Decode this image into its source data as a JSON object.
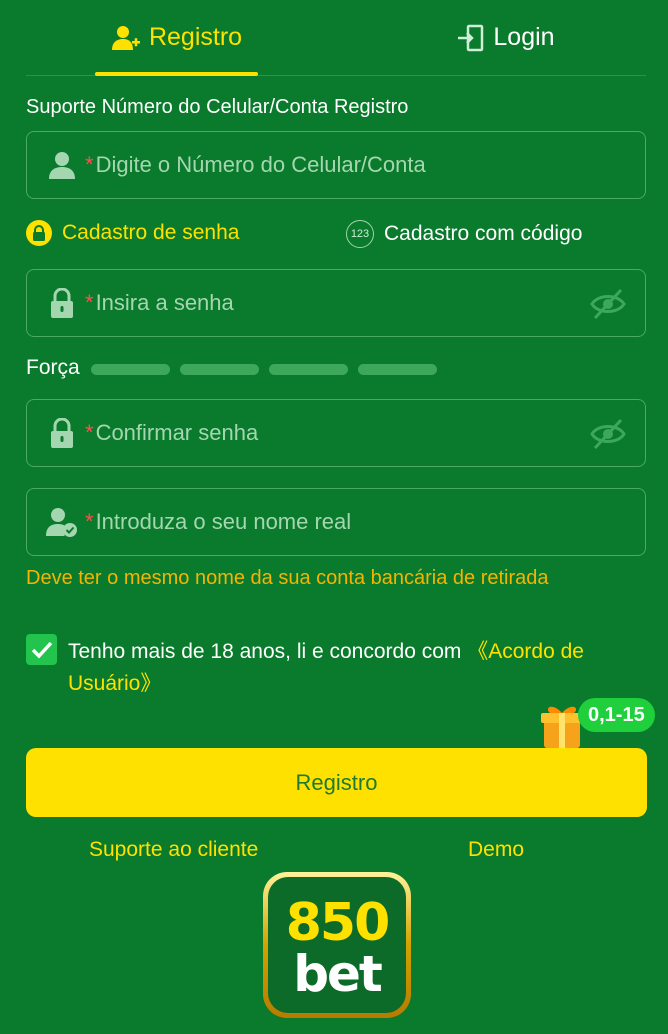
{
  "tabs": {
    "registro": "Registro",
    "login": "Login"
  },
  "support_label": "Suporte Número do Celular/Conta Registro",
  "fields": {
    "phone_placeholder": "Digite o Número do Celular/Conta",
    "password_placeholder": "Insira a senha",
    "confirm_placeholder": "Confirmar senha",
    "realname_placeholder": "Introduza o seu nome real",
    "required_mark": "*"
  },
  "modes": {
    "senha": "Cadastro de senha",
    "codigo": "Cadastro com código",
    "codigo_icon_text": "123"
  },
  "strength": {
    "label": "Força",
    "level": 0,
    "segments": 4
  },
  "hint": "Deve ter o mesmo nome da sua conta bancária de retirada",
  "agreement": {
    "checked": true,
    "text": "Tenho mais de 18 anos, li e concordo com ",
    "link": "《Acordo de Usuário》"
  },
  "gift": {
    "badge": "0,1-15"
  },
  "submit_label": "Registro",
  "links": {
    "support": "Suporte ao cliente",
    "demo": "Demo"
  },
  "logo": {
    "number": "850",
    "word": "bet"
  },
  "colors": {
    "background": "#0a7a2c",
    "accent": "#ffe100",
    "warning": "#f5b400",
    "required": "#ff4d4f"
  }
}
